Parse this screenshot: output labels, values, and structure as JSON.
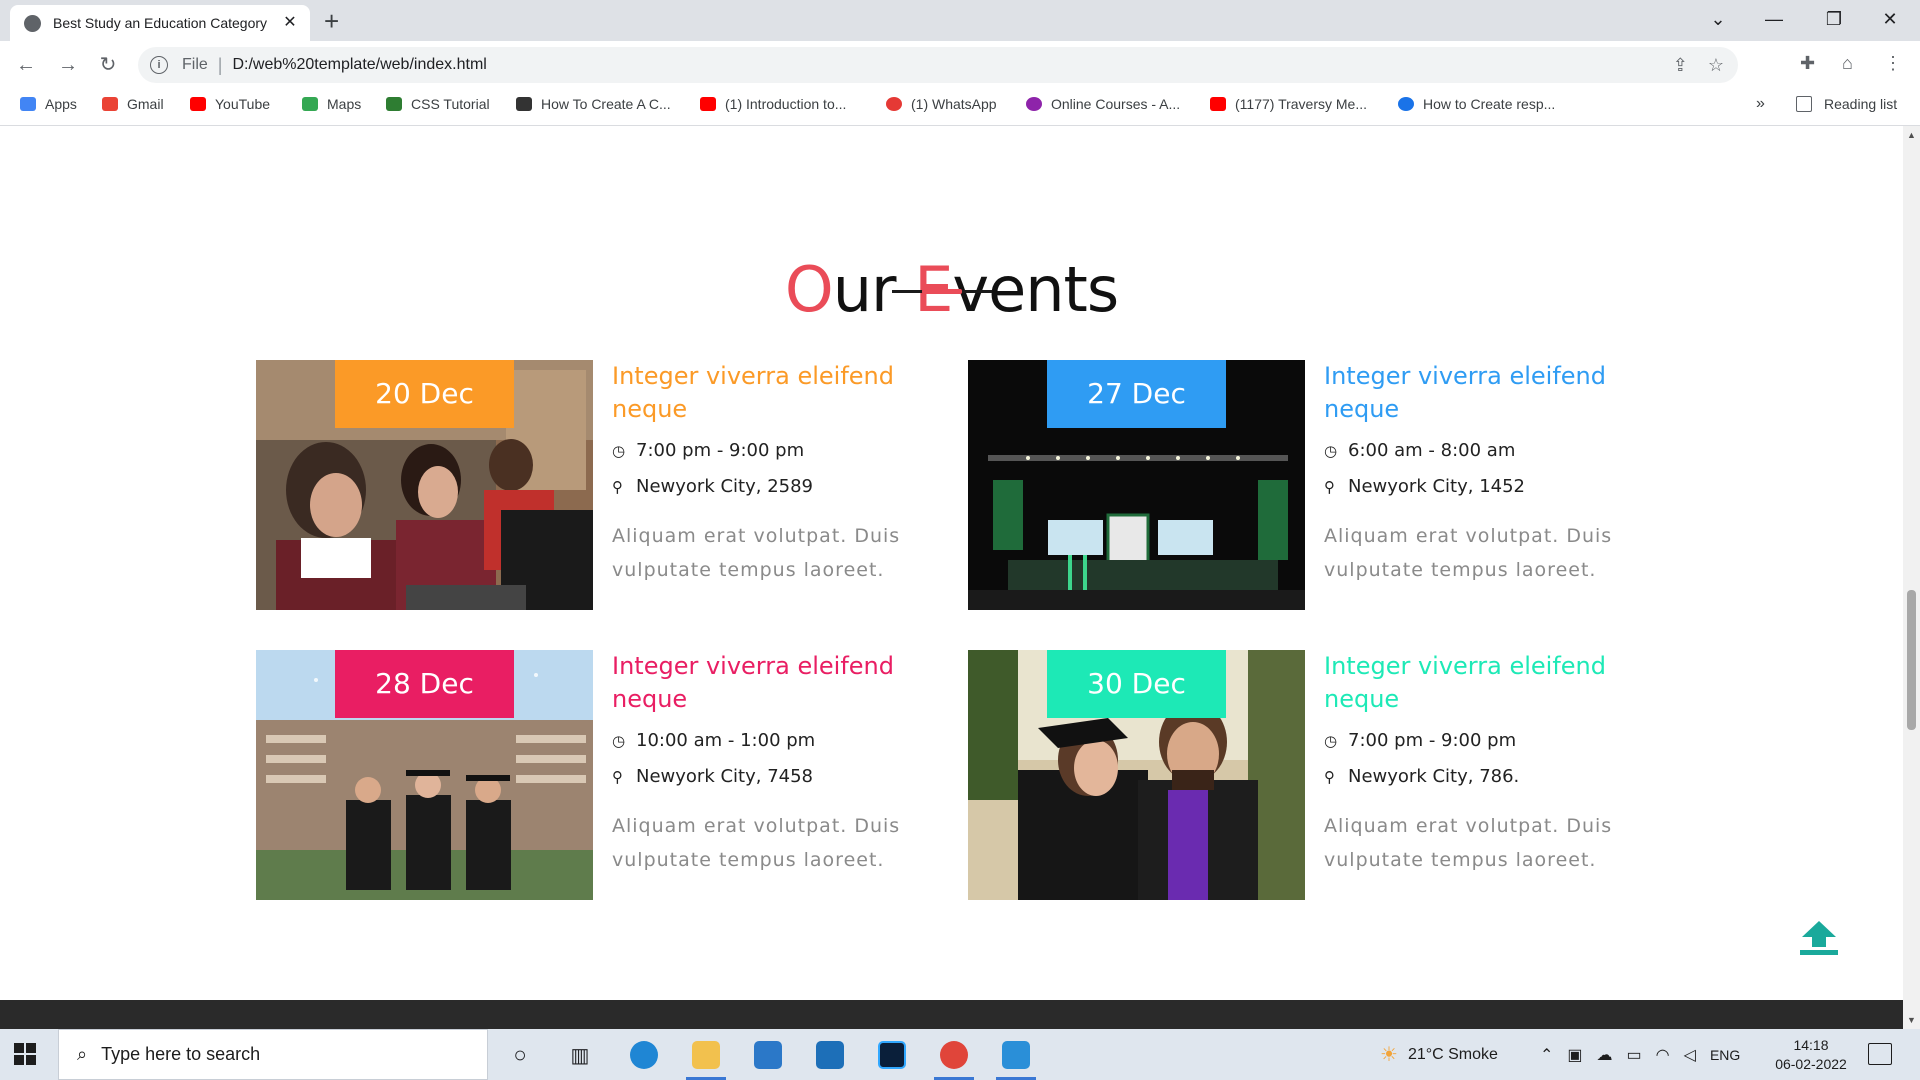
{
  "browser": {
    "tab_title": "Best Study an Education Category",
    "new_tab": "+",
    "url_scheme": "File",
    "url": "D:/web%20template/web/index.html",
    "bookmarks": [
      {
        "label": "Apps",
        "color": "#4285f4"
      },
      {
        "label": "Gmail",
        "color": "#ea4335"
      },
      {
        "label": "YouTube",
        "color": "#ff0000"
      },
      {
        "label": "Maps",
        "color": "#34a853"
      },
      {
        "label": "CSS Tutorial",
        "color": "#2e7d32"
      },
      {
        "label": "How To Create A C...",
        "color": "#333333"
      },
      {
        "label": "(1) Introduction to...",
        "color": "#ff0000"
      },
      {
        "label": "(1) WhatsApp",
        "color": "#e53935"
      },
      {
        "label": "Online Courses - A...",
        "color": "#8e24aa"
      },
      {
        "label": "(1177) Traversy Me...",
        "color": "#ff0000"
      },
      {
        "label": "How to Create resp...",
        "color": "#1a73e8"
      }
    ],
    "bookmarks_more": "»",
    "reading_list": "Reading list"
  },
  "page": {
    "title_first": "O",
    "title_mid": "ur ",
    "title_second": "E",
    "title_rest": "vents",
    "accent_color": "#ea4c58",
    "events": [
      {
        "date": "20 Dec",
        "title": "Integer viverra eleifend neque",
        "time": "7:00 pm - 9:00 pm",
        "location": "Newyork City, 2589",
        "desc": "Aliquam erat volutpat. Duis vulputate tempus laoreet.",
        "color": "#fb9a27"
      },
      {
        "date": "27 Dec",
        "title": "Integer viverra eleifend neque",
        "time": "6:00 am - 8:00 am",
        "location": "Newyork City, 1452",
        "desc": "Aliquam erat volutpat. Duis vulputate tempus laoreet.",
        "color": "#2f9cf3"
      },
      {
        "date": "28 Dec",
        "title": "Integer viverra eleifend neque",
        "time": "10:00 am - 1:00 pm",
        "location": "Newyork City, 7458",
        "desc": "Aliquam erat volutpat. Duis vulputate tempus laoreet.",
        "color": "#e91e63"
      },
      {
        "date": "30 Dec",
        "title": "Integer viverra eleifend neque",
        "time": "7:00 pm - 9:00 pm",
        "location": "Newyork City, 786.",
        "desc": "Aliquam erat volutpat. Duis vulputate tempus laoreet.",
        "color": "#1de9b6"
      }
    ]
  },
  "taskbar": {
    "search_placeholder": "Type here to search",
    "weather": "21°C  Smoke",
    "language": "ENG",
    "time": "14:18",
    "date": "06-02-2022"
  }
}
